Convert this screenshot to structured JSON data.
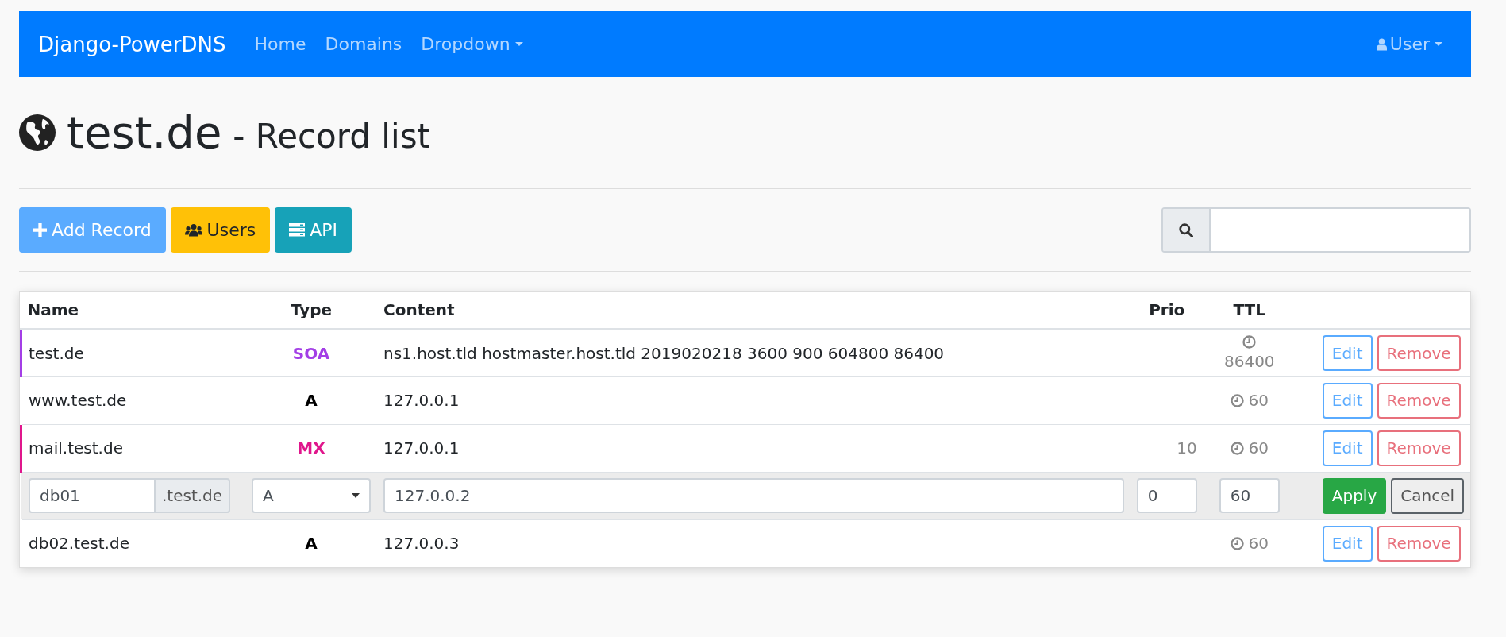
{
  "navbar": {
    "brand": "Django-PowerDNS",
    "links": [
      {
        "label": "Home",
        "kind": "link"
      },
      {
        "label": "Domains",
        "kind": "link"
      },
      {
        "label": "Dropdown",
        "kind": "dropdown"
      }
    ],
    "user_menu": {
      "label": "User"
    }
  },
  "heading": {
    "domain": "test.de",
    "subtitle": "- Record list"
  },
  "toolbar": {
    "buttons": [
      {
        "label": "Add Record",
        "kind": "add"
      },
      {
        "label": "Users",
        "kind": "users"
      },
      {
        "label": "API",
        "kind": "api"
      }
    ]
  },
  "table": {
    "columns": [
      "Name",
      "Type",
      "Content",
      "Prio",
      "TTL"
    ],
    "rows": [
      {
        "kind": "record",
        "name": "test.de",
        "type": "SOA",
        "color": "#a33ee6",
        "content": "ns1.host.tld hostmaster.host.tld 2019020218 3600 900 604800 86400",
        "ttl": "86400",
        "actions": [
          "Edit",
          "Remove"
        ]
      },
      {
        "kind": "record",
        "name": "www.test.de",
        "type": "A",
        "color": "#000000",
        "content": "127.0.0.1",
        "ttl": "60",
        "actions": [
          "Edit",
          "Remove"
        ]
      },
      {
        "kind": "record",
        "name": "mail.test.de",
        "type": "MX",
        "color": "#e0168c",
        "content": "127.0.0.1",
        "prio": "10",
        "ttl": "60",
        "actions": [
          "Edit",
          "Remove"
        ]
      },
      {
        "kind": "edit",
        "name": "db01",
        "suffix": ".test.de",
        "type": "A",
        "content": "127.0.0.2",
        "prio": "0",
        "ttl": "60",
        "actions": [
          "Apply",
          "Cancel"
        ]
      },
      {
        "kind": "record",
        "name": "db02.test.de",
        "type": "A",
        "color": "#000000",
        "content": "127.0.0.3",
        "ttl": "60",
        "actions": [
          "Edit",
          "Remove"
        ]
      }
    ]
  }
}
